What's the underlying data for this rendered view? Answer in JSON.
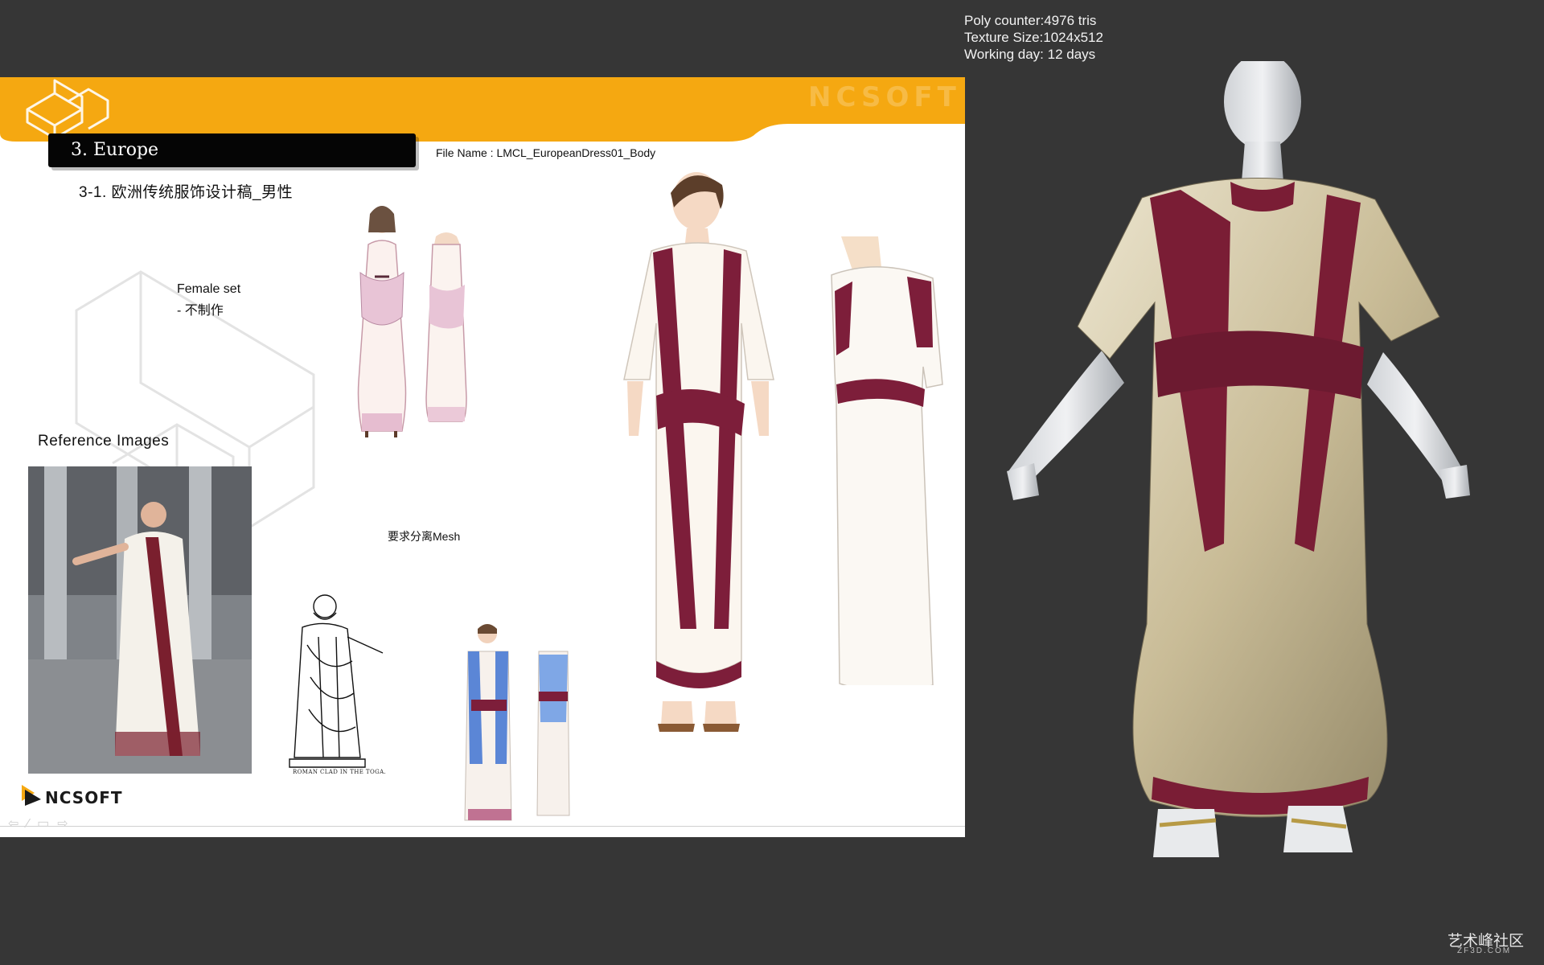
{
  "stats": {
    "poly": "Poly counter:4976 tris",
    "texture": "Texture Size:1024x512",
    "working": "Working day: 12 days"
  },
  "slide": {
    "brand_header": "NCSOFT",
    "section_title": "3. Europe",
    "file_name": "File Name : LMCL_EuropeanDress01_Body",
    "subsection_title": "3-1. 欧洲传统服饰设计稿_男性",
    "female_set_label": "Female set",
    "female_set_note": "- 不制作",
    "reference_label": "Reference Images",
    "mesh_note": "要求分离Mesh",
    "statue_caption": "ROMAN CLAD IN THE TOGA.",
    "footer_logo": "NCSOFT",
    "nav_icons": [
      "arrow-left-icon",
      "pencil-icon",
      "page-icon",
      "arrow-right-icon"
    ]
  },
  "watermark": {
    "text": "艺术峰社区",
    "sub": "ZF3D.COM"
  },
  "colors": {
    "background": "#363636",
    "header_orange": "#f5a811",
    "toga_red": "#7d1e3a",
    "toga_blue": "#5b86d6"
  }
}
